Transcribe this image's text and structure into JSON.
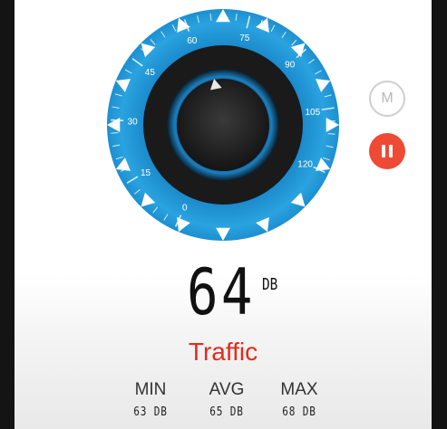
{
  "gauge": {
    "scale_labels": [
      "0",
      "15",
      "30",
      "45",
      "60",
      "75",
      "90",
      "105",
      "120"
    ],
    "current_value": 64,
    "ring_color": "#2196d6",
    "ring_color_light": "#4fb3e8"
  },
  "buttons": {
    "mode_label": "M",
    "mode_icon": "mode-m-icon",
    "pause_icon": "pause-icon",
    "pause_color": "#ef4a36"
  },
  "reading": {
    "value": "64",
    "unit": "DB"
  },
  "category": {
    "label": "Traffic",
    "color": "#e52a1b"
  },
  "stats": {
    "min_label": "MIN",
    "min_value": "63 DB",
    "avg_label": "AVG",
    "avg_value": "65 DB",
    "max_label": "MAX",
    "max_value": "68 DB"
  }
}
